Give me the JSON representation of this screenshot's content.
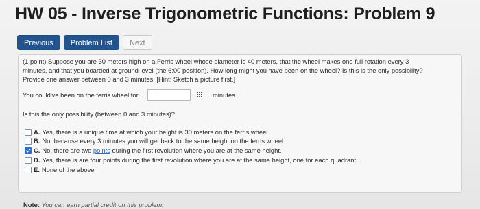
{
  "page": {
    "title": "HW 05 - Inverse Trigonometric Functions: Problem 9"
  },
  "nav": {
    "previous": "Previous",
    "problem_list": "Problem List",
    "next": "Next"
  },
  "problem": {
    "line1": "(1 point) Suppose you are 30 meters high on a Ferris wheel whose diameter is 40 meters, that the wheel makes one full rotation every 3",
    "line2": "minutes, and that you boarded at ground level (the 6:00 position). How long might you have been on the wheel? Is this is the only possibility?",
    "line3": "Provide one answer between 0 and 3 minutes. [Hint: Sketch a picture first.]",
    "answer_prefix": "You could've been on the ferris wheel for",
    "answer_value": "",
    "answer_suffix": "minutes.",
    "question": "Is this the only possibility (between 0 and 3 minutes)?",
    "options": [
      {
        "letter": "A.",
        "text": "Yes, there is a unique time at which your height is 30 meters on the ferris wheel.",
        "checked": false
      },
      {
        "letter": "B.",
        "text": "No, because every 3 minutes you will get back to the same height on the ferris wheel.",
        "checked": false
      },
      {
        "letter": "C.",
        "text_before": "No, there are two ",
        "link": "points",
        "text_after": " during the first revolution where you are at the same height.",
        "checked": true
      },
      {
        "letter": "D.",
        "text": "Yes, there is are four points during the first revolution where you are at the same height, one for each quadrant.",
        "checked": false
      },
      {
        "letter": "E.",
        "text": "None of the above",
        "checked": false
      }
    ]
  },
  "note": {
    "label": "Note:",
    "text": "You can earn partial credit on this problem."
  },
  "colors": {
    "button_blue": "#22558f",
    "checkbox_checked": "#2c70c9",
    "link": "#2f6db8"
  }
}
